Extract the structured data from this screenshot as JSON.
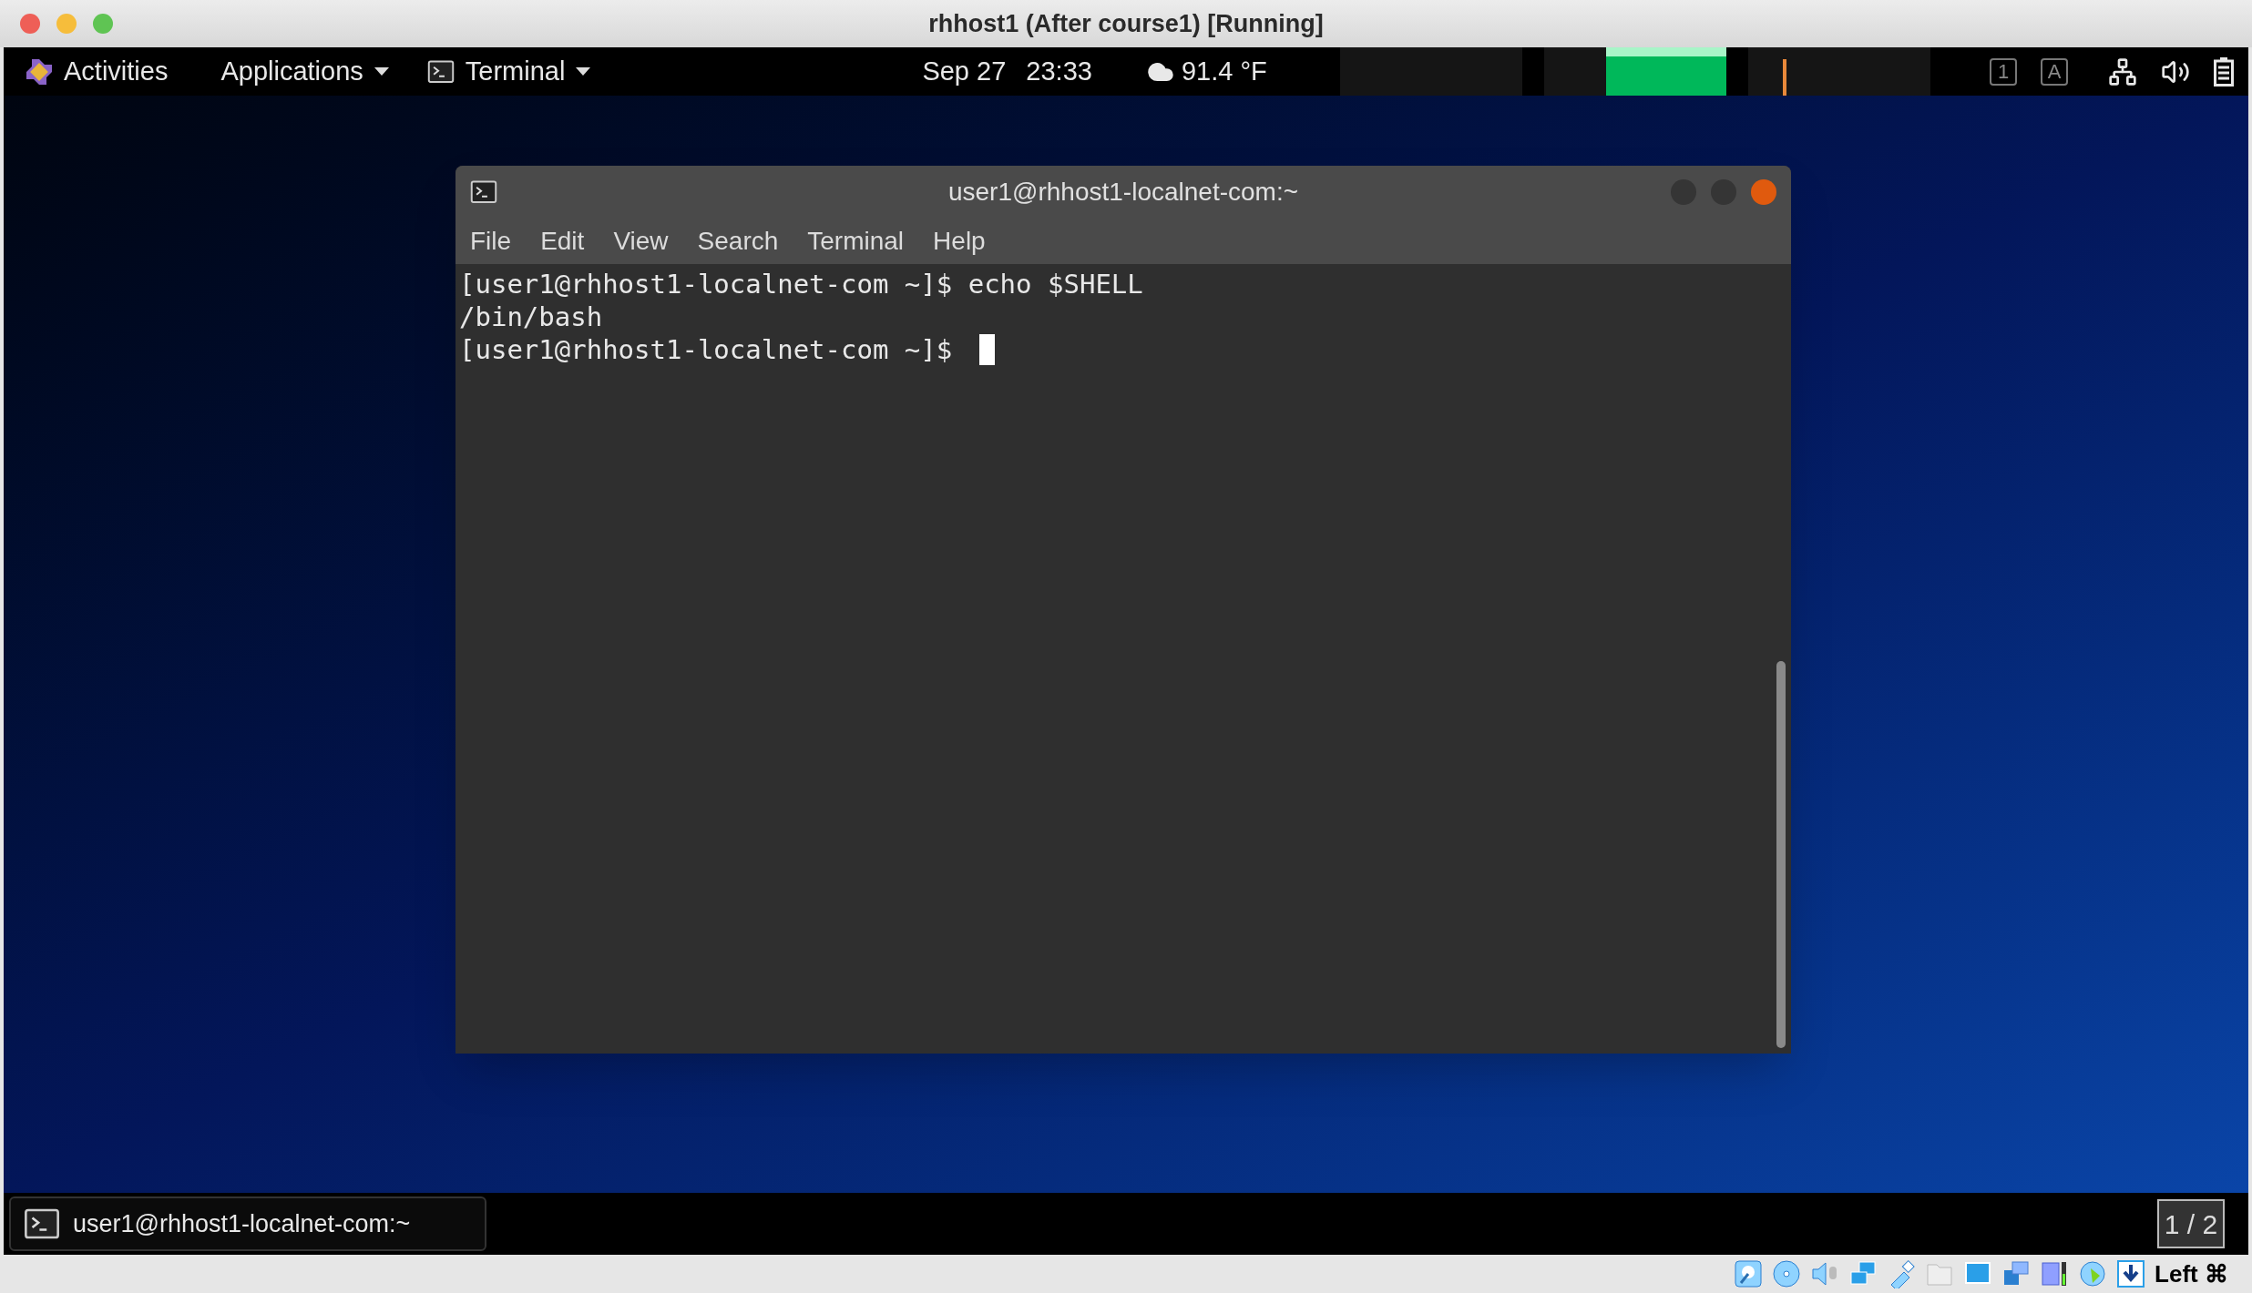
{
  "window": {
    "title": "rhhost1 (After course1) [Running]"
  },
  "top_bar": {
    "activities": "Activities",
    "applications": "Applications",
    "app_menu": "Terminal",
    "date": "Sep 27",
    "time": "23:33",
    "weather": "91.4 °F",
    "keyboard_indicators": [
      "1",
      "A"
    ]
  },
  "terminal": {
    "title": "user1@rhhost1-localnet-com:~",
    "menu": [
      "File",
      "Edit",
      "View",
      "Search",
      "Terminal",
      "Help"
    ],
    "lines": [
      "[user1@rhhost1-localnet-com ~]$ echo $SHELL",
      "/bin/bash",
      "[user1@rhhost1-localnet-com ~]$ "
    ]
  },
  "taskbar": {
    "task": "user1@rhhost1-localnet-com:~",
    "workspace": "1 / 2"
  },
  "status_bar": {
    "host_key": "Left ⌘"
  }
}
